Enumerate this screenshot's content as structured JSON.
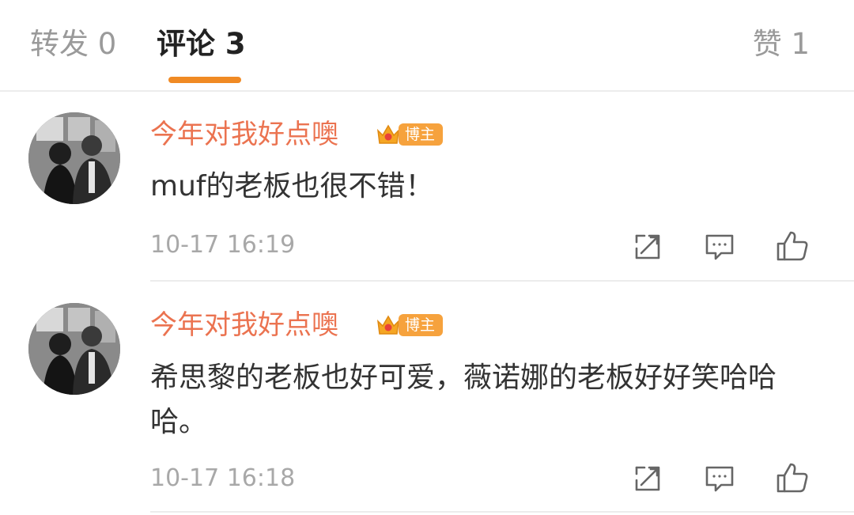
{
  "tabs": {
    "repost": "转发 0",
    "comments": "评论 3",
    "likes": "赞 1"
  },
  "comments": [
    {
      "username": "今年对我好点噢",
      "badge": "博主",
      "text": "muf的老板也很不错！",
      "time": "10-17 16:19",
      "icons": [
        "share-icon",
        "comment-icon",
        "like-icon"
      ]
    },
    {
      "username": "今年对我好点噢",
      "badge": "博主",
      "text": "希思黎的老板也好可爱，薇诺娜的老板好好笑哈哈哈。",
      "time": "10-17 16:18",
      "icons": [
        "share-icon",
        "comment-icon",
        "like-icon"
      ]
    }
  ],
  "colors": {
    "accent": "#f08a24",
    "username": "#eb7350",
    "badge": "#f6a23d",
    "text": "#333333",
    "muted": "#a8a8a8"
  }
}
